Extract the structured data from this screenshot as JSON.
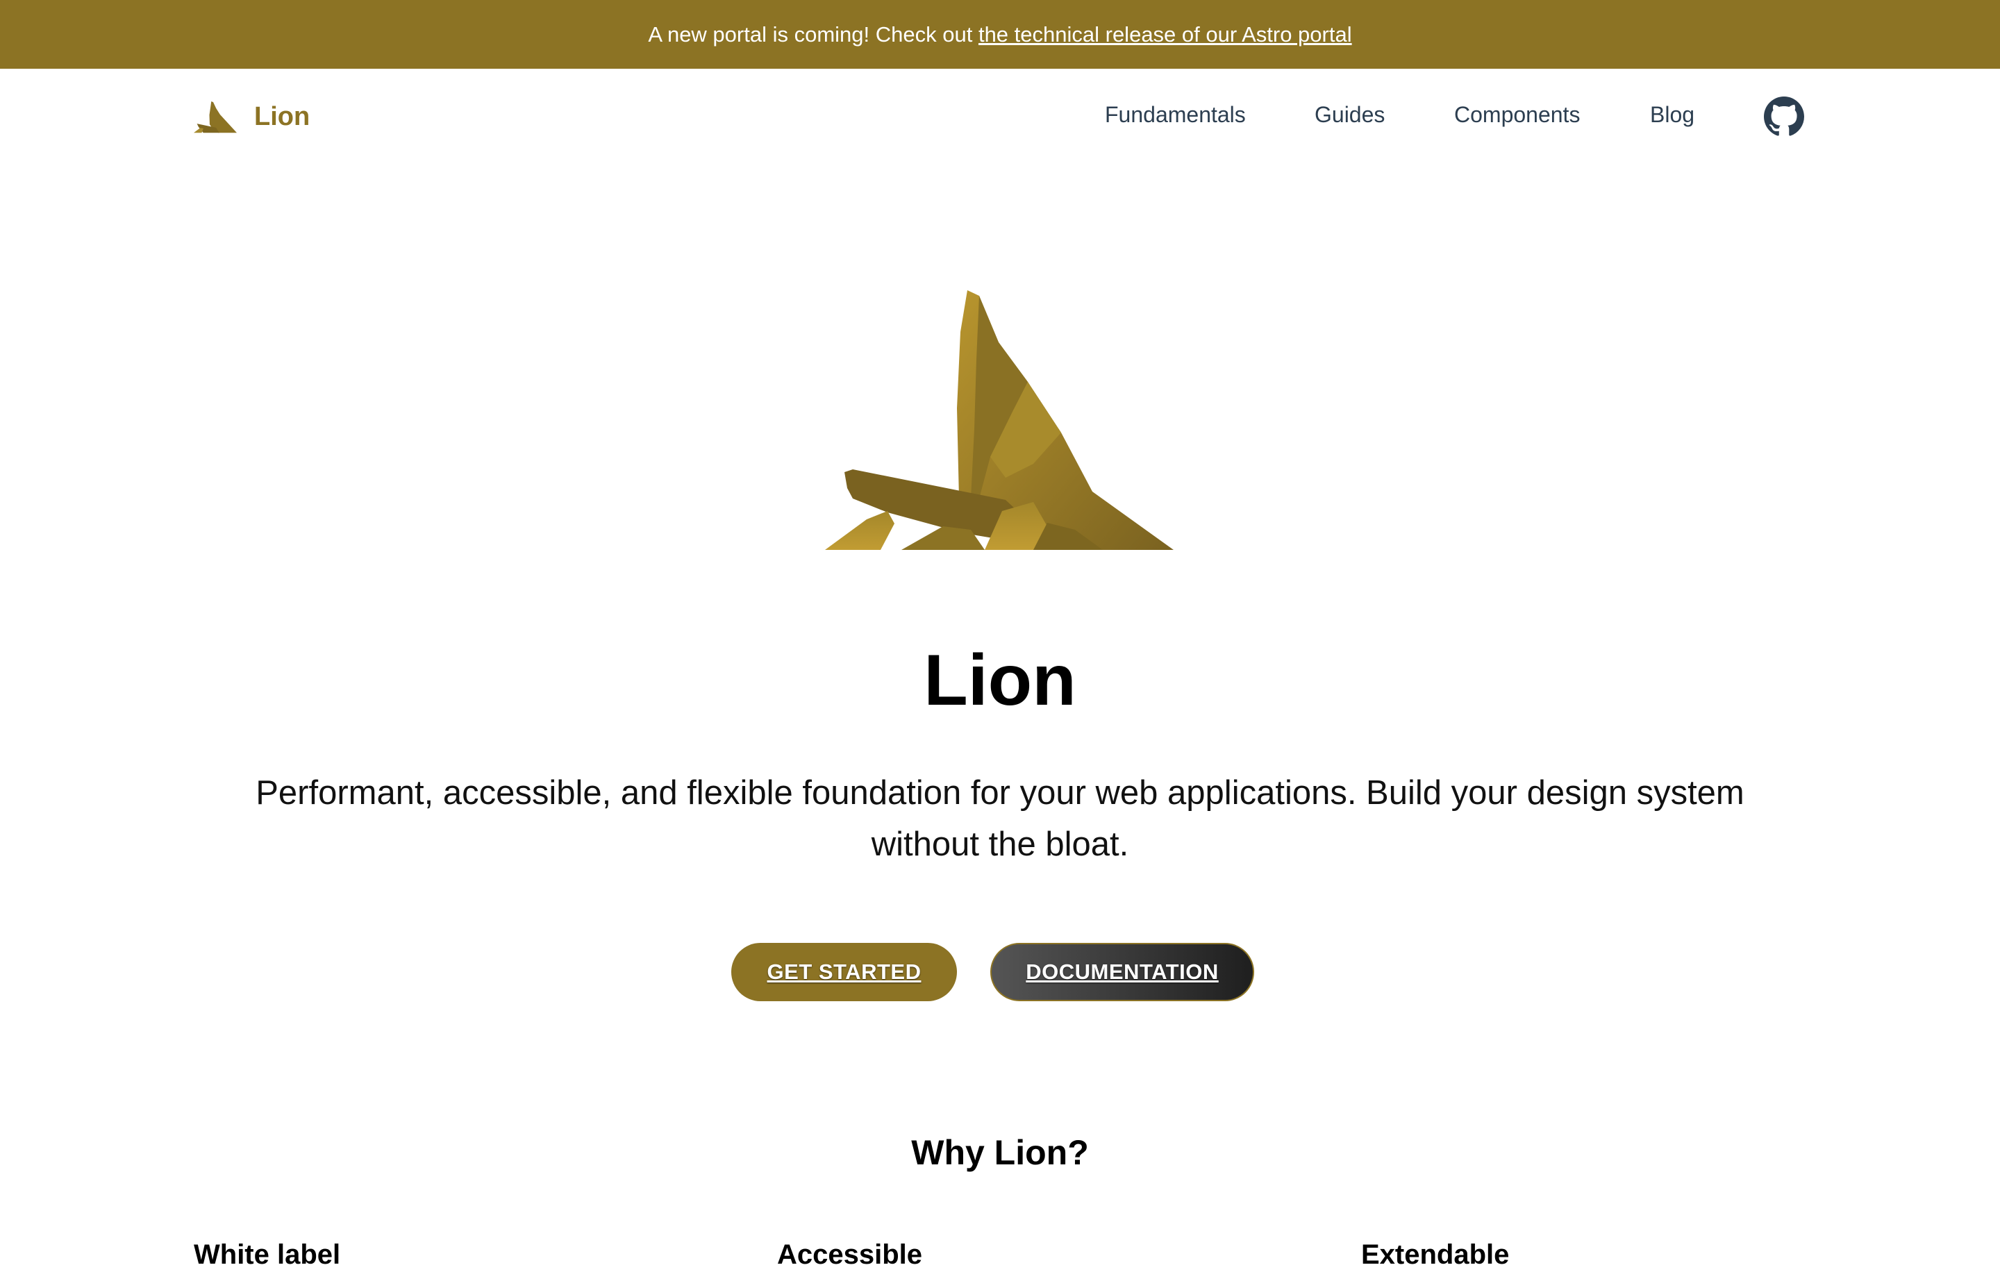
{
  "banner": {
    "text": "A new portal is coming! Check out ",
    "link_text": "the technical release of our Astro portal"
  },
  "header": {
    "brand": "Lion",
    "nav": [
      {
        "label": "Fundamentals"
      },
      {
        "label": "Guides"
      },
      {
        "label": "Components"
      },
      {
        "label": "Blog"
      }
    ],
    "github_icon": "github-icon"
  },
  "hero": {
    "title": "Lion",
    "subtitle": "Performant, accessible, and flexible foundation for your web applications. Build your design system without the bloat.",
    "primary_button": "GET STARTED",
    "secondary_button": "DOCUMENTATION"
  },
  "why": {
    "title": "Why Lion?",
    "features": [
      "White label",
      "Accessible",
      "Extendable"
    ]
  },
  "colors": {
    "brand": "#8c7324",
    "nav_text": "#2c3e50",
    "secondary_button": "#2b2b2b"
  }
}
